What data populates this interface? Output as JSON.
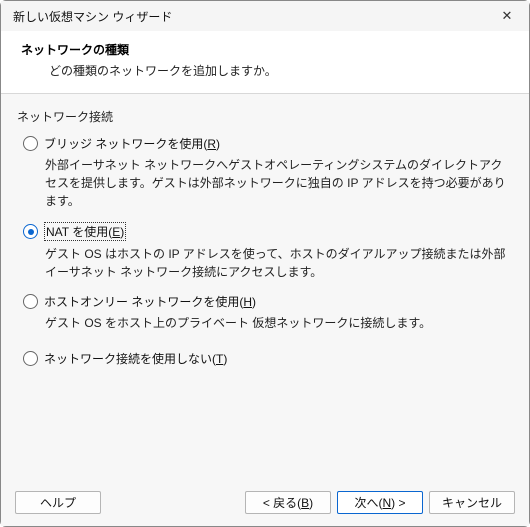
{
  "titlebar": {
    "title": "新しい仮想マシン ウィザード",
    "close_icon": "✕"
  },
  "header": {
    "heading": "ネットワークの種類",
    "subheading": "どの種類のネットワークを追加しますか。"
  },
  "group_label": "ネットワーク接続",
  "options": [
    {
      "label_pre": "ブリッジ ネットワークを使用(",
      "accel": "R",
      "label_post": ")",
      "checked": false,
      "desc": "外部イーサネット ネットワークへゲストオペレーティングシステムのダイレクトアクセスを提供します。ゲストは外部ネットワークに独自の IP アドレスを持つ必要があります。"
    },
    {
      "label_pre": "NAT を使用(",
      "accel": "E",
      "label_post": ")",
      "checked": true,
      "desc": "ゲスト OS はホストの IP アドレスを使って、ホストのダイアルアップ接続または外部イーサネット ネットワーク接続にアクセスします。"
    },
    {
      "label_pre": "ホストオンリー ネットワークを使用(",
      "accel": "H",
      "label_post": ")",
      "checked": false,
      "desc": "ゲスト OS をホスト上のプライベート 仮想ネットワークに接続します。"
    },
    {
      "label_pre": "ネットワーク接続を使用しない(",
      "accel": "T",
      "label_post": ")",
      "checked": false,
      "desc": ""
    }
  ],
  "footer": {
    "help": "ヘルプ",
    "back_pre": "< 戻る(",
    "back_acc": "B",
    "back_post": ")",
    "next_pre": "次へ(",
    "next_acc": "N",
    "next_post": ") >",
    "cancel": "キャンセル"
  }
}
